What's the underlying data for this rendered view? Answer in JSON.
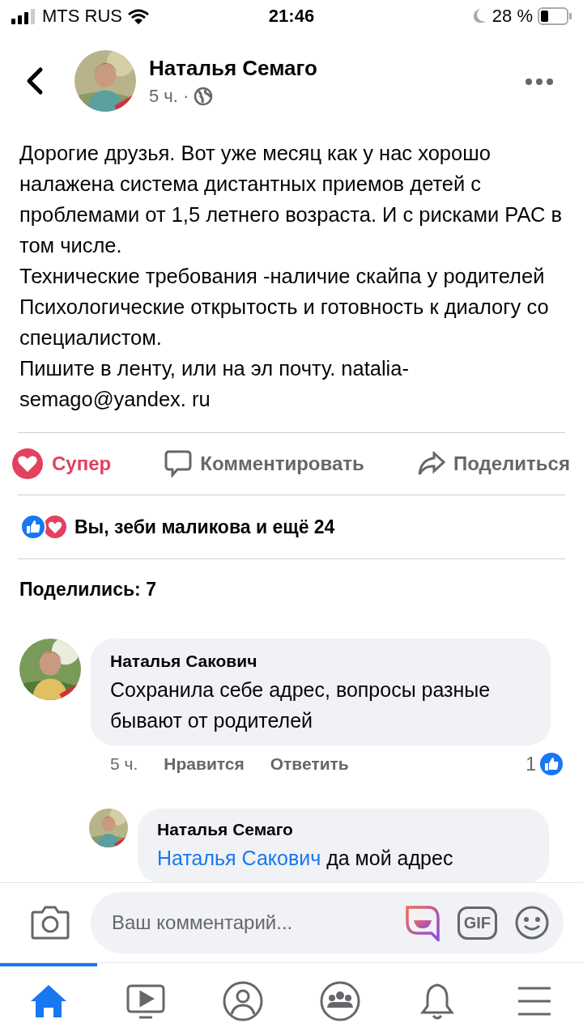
{
  "status_bar": {
    "carrier": "MTS RUS",
    "time": "21:46",
    "battery": "28 %"
  },
  "post": {
    "author": "Наталья Семаго",
    "time": "5 ч.",
    "separator": "·",
    "paragraphs": [
      "Дорогие друзья.  Вот уже месяц как у нас хорошо налажена система дистантных приемов детей с проблемами от 1,5 летнего возраста.  И с рисками РАС в том числе.",
      "Технические требования -наличие скайпа у родителей",
      "Психологические открытость и готовность к диалогу со специалистом.",
      "Пишите в ленту, или на эл почту.  natalia-semago@yandex. ru"
    ]
  },
  "actions": [
    {
      "kind": "reaction",
      "label": "Супер",
      "active": true
    },
    {
      "kind": "comment",
      "label": "Комментировать",
      "active": false
    },
    {
      "kind": "share",
      "label": "Поделиться",
      "active": false
    }
  ],
  "reactions_summary": "Вы, зеби маликова и ещё 24",
  "shares": "Поделились: 7",
  "comments": [
    {
      "author": "Наталья Сакович",
      "text": "Сохранила себе адрес, вопросы разные бывают от родителей",
      "time": "5 ч.",
      "like": "Нравится",
      "reply": "Ответить",
      "likes": "1",
      "replies": [
        {
          "author": "Наталья Семаго",
          "mention": "Наталья Сакович",
          "text": "да мой адрес"
        }
      ]
    }
  ],
  "composer": {
    "placeholder": "Ваш комментарий...",
    "gif": "GIF"
  },
  "tabs": [
    {
      "kind": "home",
      "selected": true
    },
    {
      "kind": "video",
      "selected": false
    },
    {
      "kind": "profile",
      "selected": false
    },
    {
      "kind": "groups",
      "selected": false
    },
    {
      "kind": "notifications",
      "selected": false
    },
    {
      "kind": "menu",
      "selected": false
    }
  ]
}
